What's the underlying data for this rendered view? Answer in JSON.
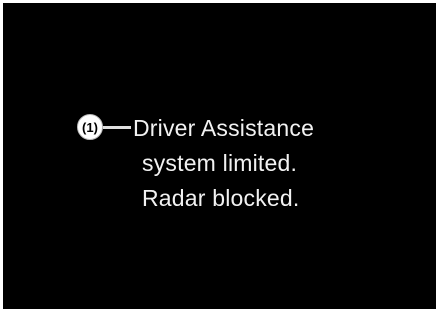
{
  "callout": {
    "label": "(1)"
  },
  "display": {
    "lines": [
      "Driver Assistance",
      "system limited.",
      "Radar blocked."
    ],
    "background_color": "#000000",
    "text_color": "#f2f2f2"
  }
}
